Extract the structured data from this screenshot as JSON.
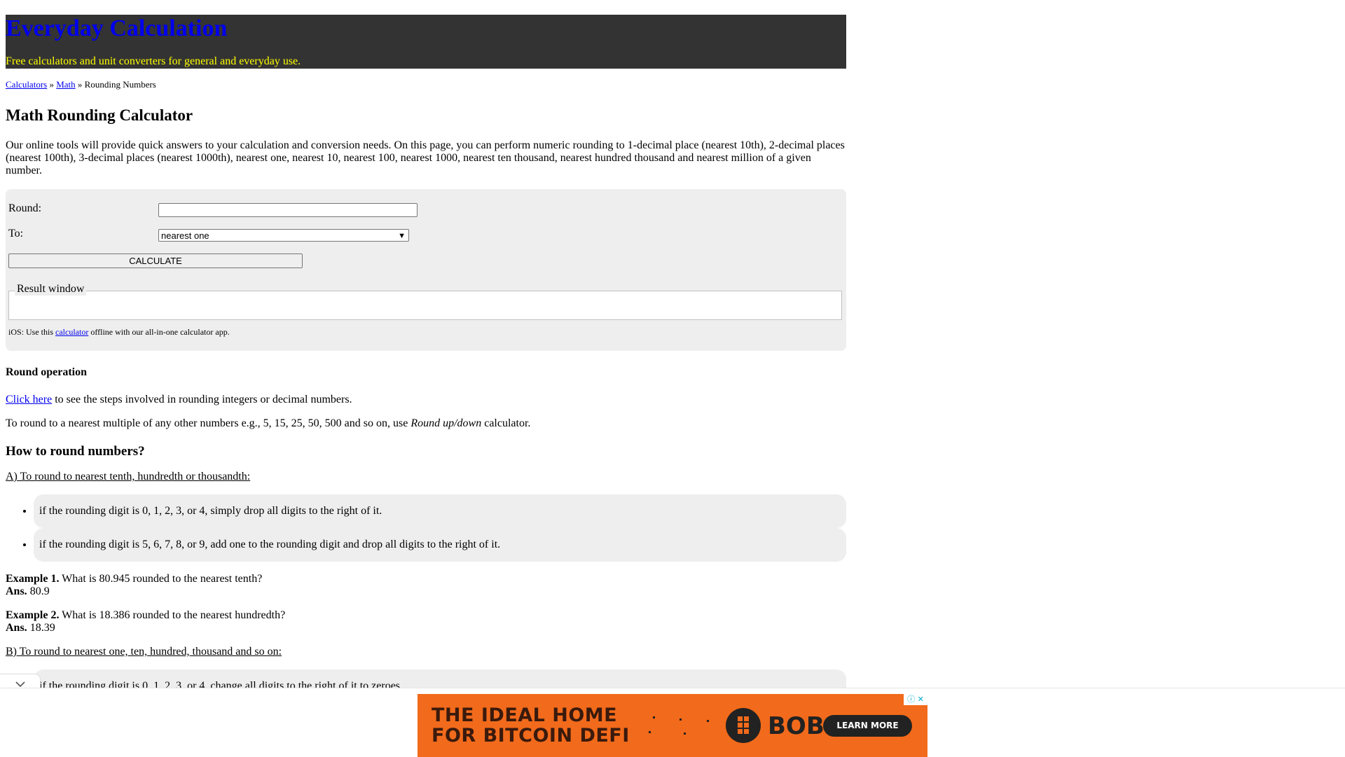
{
  "header": {
    "site_title": "Everyday Calculation",
    "tagline": "Free calculators and unit converters for general and everyday use."
  },
  "breadcrumb": {
    "item1": "Calculators",
    "sep1": " » ",
    "item2": "Math",
    "sep2": " » ",
    "current": "Rounding Numbers"
  },
  "page_title": "Math Rounding Calculator",
  "intro": "Our online tools will provide quick answers to your calculation and conversion needs. On this page, you can perform numeric rounding to 1-decimal place (nearest 10th), 2-decimal places (nearest 100th), 3-decimal places (nearest 1000th), nearest one, nearest 10, nearest 100, nearest 1000, nearest ten thousand, nearest hundred thousand and nearest million of a given number.",
  "calculator": {
    "round_label": "Round:",
    "round_value": "",
    "to_label": "To:",
    "to_selected": "nearest one",
    "calculate_label": "CALCULATE",
    "result_legend": "Result window",
    "ios_prefix": "iOS: Use this ",
    "ios_link": "calculator",
    "ios_suffix": " offline with our all-in-one calculator app."
  },
  "round_operation": {
    "heading": "Round operation",
    "click_link": "Click here",
    "click_text": " to see the steps involved in rounding integers or decimal numbers.",
    "multiple_prefix": "To round to a nearest multiple of any other numbers e.g., 5, 15, 25, 50, 500 and so on, use ",
    "multiple_em": "Round up/down",
    "multiple_suffix": " calculator."
  },
  "how_to": {
    "heading": "How to round numbers?",
    "section_a": "A) To round to nearest tenth, hundredth or thousandth:",
    "rules_a": [
      "if the rounding digit is 0, 1, 2, 3, or 4, simply drop all digits to the right of it.",
      "if the rounding digit is 5, 6, 7, 8, or 9, add one to the rounding digit and drop all digits to the right of it."
    ],
    "example1_label": "Example 1.",
    "example1_q": " What is 80.945 rounded to the nearest tenth?",
    "example1_ans_label": "Ans.",
    "example1_ans": " 80.9",
    "example2_label": "Example 2.",
    "example2_q": " What is 18.386 rounded to the nearest hundredth?",
    "example2_ans_label": "Ans.",
    "example2_ans": " 18.39",
    "section_b": "B) To round to nearest one, ten, hundred, thousand and so on:",
    "rules_b": [
      "if the rounding digit is 0, 1, 2, 3, or 4, change all digits to the right of it to zeroes."
    ]
  },
  "ad": {
    "headline_line1": "THE IDEAL HOME",
    "headline_line2": "FOR BITCOIN DEFI",
    "brand": "BOB",
    "cta": "LEARN MORE",
    "bg_color": "#f26a1b"
  },
  "icons": {
    "collapse": "chevron-down-icon",
    "ad_info": "info-icon",
    "ad_close": "close-icon"
  }
}
